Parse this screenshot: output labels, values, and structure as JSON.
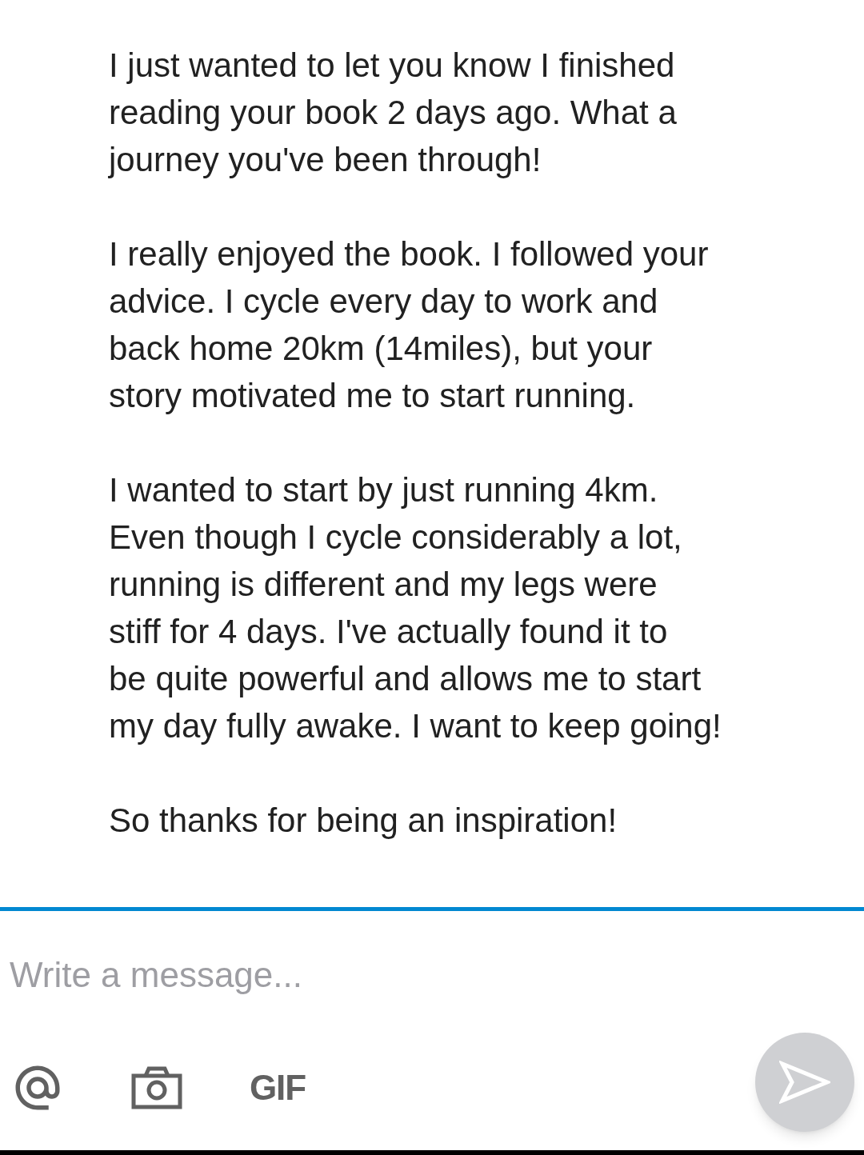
{
  "message": {
    "paragraphs": [
      {
        "lines": [
          "I just wanted to let you know I finished",
          "reading your book 2 days ago. What a",
          "journey you've been through!"
        ]
      },
      {
        "lines": [
          "I really enjoyed the book. I followed your",
          "advice. I cycle every day to work and",
          "back home 20km (14miles), but your",
          "story motivated me to start running."
        ]
      },
      {
        "lines": [
          "I wanted to start by just running 4km.",
          "Even though I cycle considerably a lot,",
          "running is different and my legs were",
          "stiff for 4 days. I've actually found it to",
          "be quite powerful and allows me to start",
          "my day fully awake. I want to keep going!"
        ]
      },
      {
        "lines": [
          "So thanks for being an inspiration!"
        ]
      }
    ]
  },
  "composer": {
    "placeholder": "Write a message...",
    "gif_label": "GIF",
    "send": {
      "disabled": true
    }
  }
}
